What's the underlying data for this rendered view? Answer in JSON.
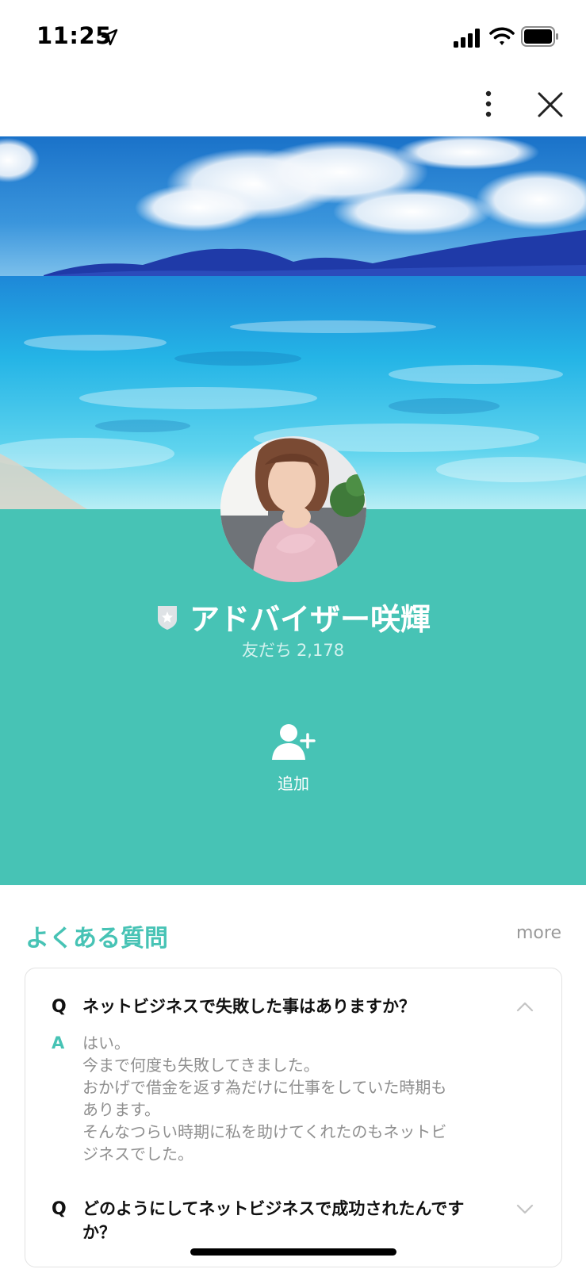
{
  "status_bar": {
    "time": "11:25"
  },
  "header": {
    "more_icon": "more-vertical-icon",
    "close_icon": "close-icon"
  },
  "colors": {
    "accent": "#47c3b5",
    "panel": "#47c3b5",
    "muted_text": "#8f8f8f"
  },
  "profile": {
    "name": "アドバイザー咲輝",
    "friends_label": "友だち",
    "friends_count": "2,178",
    "add_label": "追加",
    "badge_icon": "shield-star-icon"
  },
  "faq": {
    "title": "よくある質問",
    "more_label": "more",
    "items": [
      {
        "q_mark": "Q",
        "question": "ネットビジネスで失敗した事はありますか？",
        "expanded": true,
        "a_mark": "A",
        "answer_lines": [
          "はい。",
          "今まで何度も失敗してきました。",
          "おかげで借金を返す為だけに仕事をしていた時期も",
          "あります。",
          "そんなつらい時期に私を助けてくれたのもネットビ",
          "ジネスでした。"
        ]
      },
      {
        "q_mark": "Q",
        "question_lines": [
          "どのようにしてネットビジネスで成功されたんです",
          "か？"
        ],
        "expanded": false
      }
    ]
  }
}
